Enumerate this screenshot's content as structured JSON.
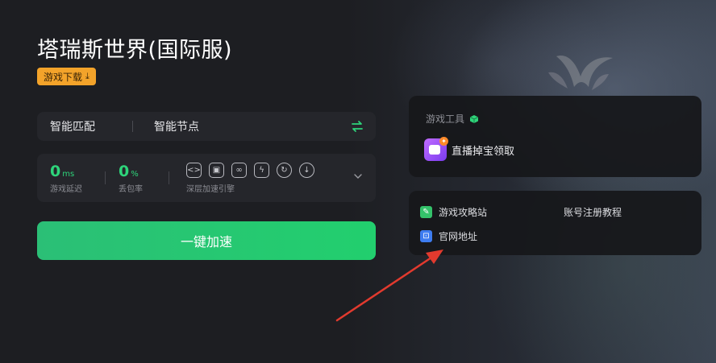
{
  "game": {
    "title": "塔瑞斯世界(国际服)",
    "download_label": "游戏下载"
  },
  "node_bar": {
    "option_1": "智能匹配",
    "option_2": "智能节点"
  },
  "stats": {
    "latency": {
      "value": "0",
      "unit": "ms",
      "label": "游戏延迟"
    },
    "packet_loss": {
      "value": "0",
      "unit": "%",
      "label": "丢包率"
    },
    "engine_label": "深层加速引擎"
  },
  "boost_button": "一键加速",
  "tools": {
    "header": "游戏工具",
    "live_label": "直播掉宝领取"
  },
  "links": {
    "guide": "游戏攻略站",
    "register": "账号注册教程",
    "official": "官网地址"
  },
  "colors": {
    "accent_green": "#2ed47a",
    "download_orange": "#f3a32a",
    "arrow_red": "#e23a2e"
  }
}
